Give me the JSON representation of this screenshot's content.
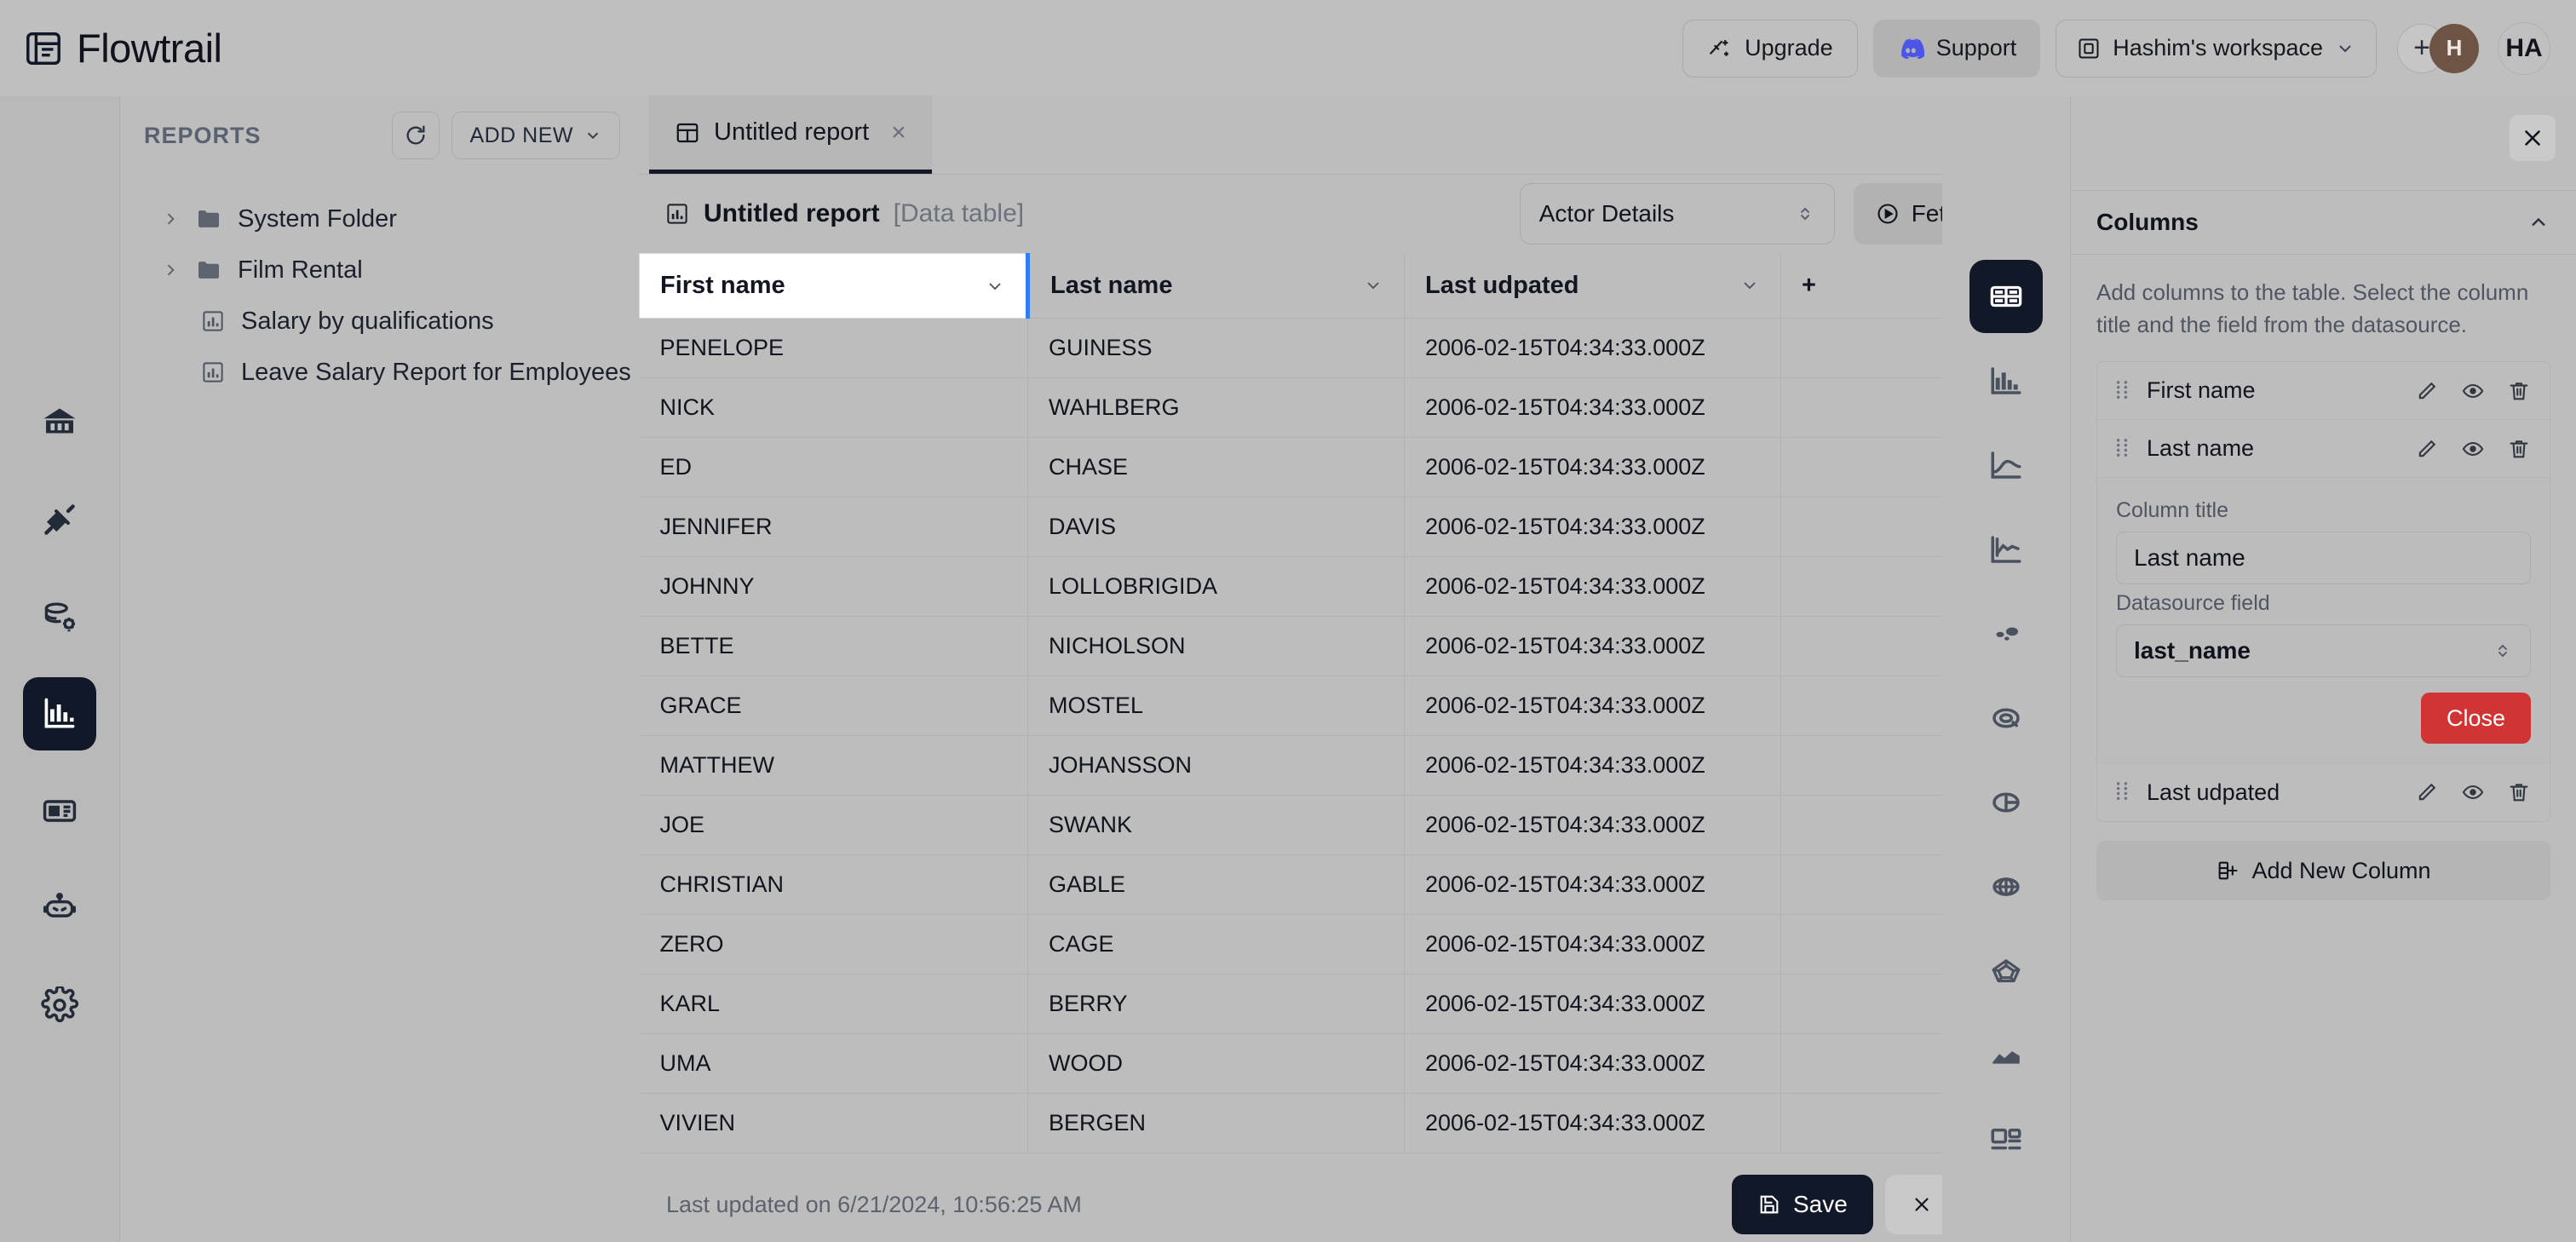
{
  "app": {
    "brand": "Flowtrail"
  },
  "header": {
    "upgrade_label": "Upgrade",
    "support_label": "Support",
    "workspace_label": "Hashim's workspace",
    "avatar_plus": "+",
    "avatar_initial": "H",
    "avatar_user": "HA"
  },
  "rail": {
    "items": [
      {
        "name": "home-icon"
      },
      {
        "name": "connections-icon"
      },
      {
        "name": "datasource-settings-icon"
      },
      {
        "name": "reports-icon",
        "active": true
      },
      {
        "name": "dashboard-icon"
      },
      {
        "name": "ai-assistant-icon"
      },
      {
        "name": "settings-icon"
      }
    ]
  },
  "reports_panel": {
    "title": "REPORTS",
    "refresh_icon": "refresh-icon",
    "add_new_label": "ADD NEW",
    "tree": [
      {
        "label": "System Folder",
        "type": "folder"
      },
      {
        "label": "Film Rental",
        "type": "folder"
      },
      {
        "label": "Salary by qualifications",
        "type": "report"
      },
      {
        "label": "Leave Salary Report for Employees",
        "type": "report"
      }
    ]
  },
  "workspace": {
    "tab_label": "Untitled report",
    "tab_close": "×",
    "report_title": "Untitled report",
    "report_subtitle": "[Data table]",
    "datasource_value": "Actor Details",
    "fetch_label": "Fetch data",
    "add_column_plus": "+"
  },
  "table": {
    "columns": [
      {
        "label": "First name",
        "selected": true
      },
      {
        "label": "Last name",
        "selected": false
      },
      {
        "label": "Last udpated",
        "selected": false
      }
    ],
    "rows": [
      [
        "PENELOPE",
        "GUINESS",
        "2006-02-15T04:34:33.000Z"
      ],
      [
        "NICK",
        "WAHLBERG",
        "2006-02-15T04:34:33.000Z"
      ],
      [
        "ED",
        "CHASE",
        "2006-02-15T04:34:33.000Z"
      ],
      [
        "JENNIFER",
        "DAVIS",
        "2006-02-15T04:34:33.000Z"
      ],
      [
        "JOHNNY",
        "LOLLOBRIGIDA",
        "2006-02-15T04:34:33.000Z"
      ],
      [
        "BETTE",
        "NICHOLSON",
        "2006-02-15T04:34:33.000Z"
      ],
      [
        "GRACE",
        "MOSTEL",
        "2006-02-15T04:34:33.000Z"
      ],
      [
        "MATTHEW",
        "JOHANSSON",
        "2006-02-15T04:34:33.000Z"
      ],
      [
        "JOE",
        "SWANK",
        "2006-02-15T04:34:33.000Z"
      ],
      [
        "CHRISTIAN",
        "GABLE",
        "2006-02-15T04:34:33.000Z"
      ],
      [
        "ZERO",
        "CAGE",
        "2006-02-15T04:34:33.000Z"
      ],
      [
        "KARL",
        "BERRY",
        "2006-02-15T04:34:33.000Z"
      ],
      [
        "UMA",
        "WOOD",
        "2006-02-15T04:34:33.000Z"
      ],
      [
        "VIVIEN",
        "BERGEN",
        "2006-02-15T04:34:33.000Z"
      ]
    ]
  },
  "chart_types": [
    {
      "name": "table-chart-icon",
      "active": true
    },
    {
      "name": "bar-chart-icon",
      "active": false
    },
    {
      "name": "line-chart-icon",
      "active": false
    },
    {
      "name": "area-line-chart-icon",
      "active": false
    },
    {
      "name": "scatter-chart-icon",
      "active": false
    },
    {
      "name": "donut-chart-icon",
      "active": false
    },
    {
      "name": "pie-chart-icon",
      "active": false
    },
    {
      "name": "polar-chart-icon",
      "active": false
    },
    {
      "name": "radar-chart-icon",
      "active": false
    },
    {
      "name": "area-chart-icon",
      "active": false
    },
    {
      "name": "layout-chart-icon",
      "active": false
    }
  ],
  "columns_panel": {
    "close_icon": "close-icon",
    "title": "Columns",
    "collapse_icon": "chevron-up-icon",
    "help_text": "Add columns to the table. Select the column title and the field from the datasource.",
    "items": [
      {
        "label": "First name",
        "editing": false
      },
      {
        "label": "Last name",
        "editing": true
      },
      {
        "label": "Last udpated",
        "editing": false
      }
    ],
    "editor": {
      "column_title_label": "Column title",
      "column_title_value": "Last name",
      "datasource_field_label": "Datasource field",
      "datasource_field_value": "last_name",
      "close_label": "Close"
    },
    "add_new_column_label": "Add New Column"
  },
  "footer": {
    "last_updated": "Last updated on 6/21/2024, 10:56:25 AM",
    "save_label": "Save",
    "cancel_label": "Cancel"
  },
  "colors": {
    "accent_dark": "#111827",
    "selection_blue": "#2f7df6",
    "danger_red": "#d03434",
    "discord_blurple": "#4b55e8",
    "avatar_brown": "#6e5445"
  }
}
